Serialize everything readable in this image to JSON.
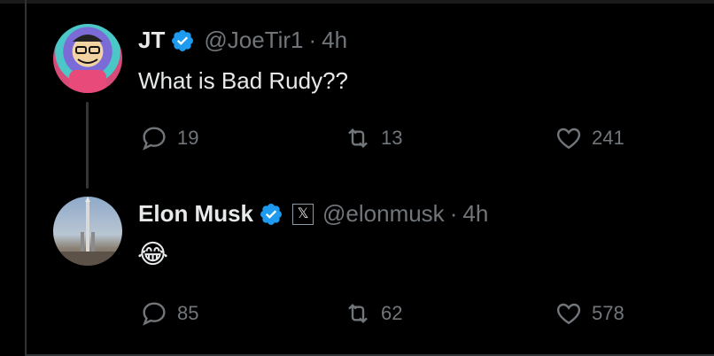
{
  "tweets": [
    {
      "name": "JT",
      "handle": "@JoeTir1",
      "separator": "·",
      "time": "4h",
      "text": "What is Bad Rudy??",
      "replies": "19",
      "retweets": "13",
      "likes": "241",
      "verified_color": "#1d9bf0"
    },
    {
      "name": "Elon Musk",
      "handle": "@elonmusk",
      "separator": "·",
      "time": "4h",
      "emoji": "😂",
      "affiliate_badge": "𝕏",
      "replies": "85",
      "retweets": "62",
      "likes": "578",
      "verified_color": "#1d9bf0"
    }
  ]
}
